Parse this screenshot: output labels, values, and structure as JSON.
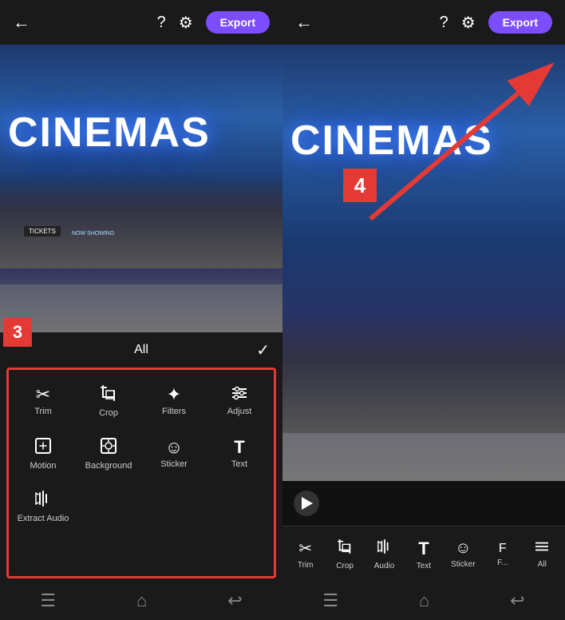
{
  "left": {
    "back_icon": "←",
    "help_icon": "?",
    "settings_icon": "⚙",
    "export_label": "Export",
    "video_text": "CINEMAS",
    "tickets_label": "TICKETS",
    "now_showing_label": "NOW SHOWING",
    "badge3": "3",
    "tools_header": "All",
    "check_icon": "✓",
    "tools": [
      {
        "icon": "✂",
        "label": "Trim"
      },
      {
        "icon": "⬜",
        "label": "Crop"
      },
      {
        "icon": "❋",
        "label": "Filters"
      },
      {
        "icon": "≡",
        "label": "Adjust"
      },
      {
        "icon": "⬜",
        "label": "Motion"
      },
      {
        "icon": "⊗",
        "label": "Background"
      },
      {
        "icon": "☺",
        "label": "Sticker"
      },
      {
        "icon": "T",
        "label": "Text"
      },
      {
        "icon": "📢",
        "label": "Extract Audio"
      }
    ],
    "nav_icons": [
      "≡",
      "⌂",
      "↩"
    ]
  },
  "right": {
    "back_icon": "←",
    "help_icon": "?",
    "settings_icon": "⚙",
    "export_label": "Export",
    "video_text": "CINEMAS",
    "badge4": "4",
    "tools": [
      {
        "icon": "✂",
        "label": "Trim"
      },
      {
        "icon": "⬜",
        "label": "Crop"
      },
      {
        "icon": "📢",
        "label": "Audio"
      },
      {
        "icon": "T",
        "label": "Text"
      },
      {
        "icon": "☺",
        "label": "Sticker"
      },
      {
        "icon": "F",
        "label": "F..."
      },
      {
        "icon": "≡",
        "label": "All"
      }
    ],
    "nav_icons": [
      "≡",
      "⌂",
      "↩"
    ]
  }
}
